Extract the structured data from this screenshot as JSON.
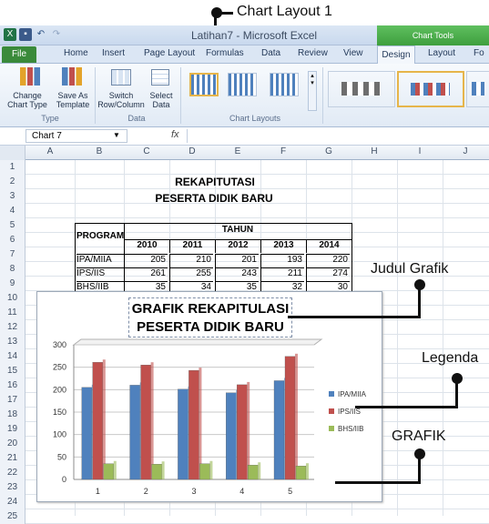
{
  "annotations": {
    "chart_layout": "Chart Layout 1",
    "judul": "Judul Grafik",
    "legenda": "Legenda",
    "grafik": "GRAFIK"
  },
  "window": {
    "title": "Latihan7 - Microsoft Excel",
    "context_tab": "Chart Tools"
  },
  "tabs": [
    "File",
    "Home",
    "Insert",
    "Page Layout",
    "Formulas",
    "Data",
    "Review",
    "View",
    "Design",
    "Layout",
    "Fo"
  ],
  "ribbon": {
    "change_chart_type": "Change\nChart Type",
    "save_as_template": "Save As\nTemplate",
    "group_type": "Type",
    "switch": "Switch\nRow/Column",
    "select_data": "Select\nData",
    "group_data": "Data",
    "group_chart_layouts": "Chart Layouts"
  },
  "formula": {
    "name_box": "Chart 7",
    "fx": "fx"
  },
  "columns": [
    "A",
    "B",
    "C",
    "D",
    "E",
    "F",
    "G",
    "H",
    "I",
    "J"
  ],
  "rows": [
    "1",
    "2",
    "3",
    "4",
    "5",
    "6",
    "7",
    "8",
    "9",
    "10",
    "11",
    "12",
    "13",
    "14",
    "15",
    "16",
    "17",
    "18",
    "19",
    "20",
    "21",
    "22",
    "23",
    "24",
    "25"
  ],
  "sheet": {
    "title1": "REKAPITUTASI",
    "title2": "PESERTA DIDIK BARU",
    "hdr_program": "PROGRAM",
    "hdr_tahun": "TAHUN",
    "years": [
      "2010",
      "2011",
      "2012",
      "2013",
      "2014"
    ],
    "rows": [
      {
        "program": "IPA/MIIA",
        "values": [
          "205",
          "210",
          "201",
          "193",
          "220"
        ]
      },
      {
        "program": "IPS/IIS",
        "values": [
          "261",
          "255",
          "243",
          "211",
          "274"
        ]
      },
      {
        "program": "BHS/IIB",
        "values": [
          "35",
          "34",
          "35",
          "32",
          "30"
        ]
      }
    ]
  },
  "chart_data": {
    "type": "bar",
    "title": "GRAFIK REKAPITULASI PESERTA DIDIK BARU",
    "title_line1": "GRAFIK REKAPITULASI",
    "title_line2": "PESERTA DIDIK BARU",
    "categories": [
      "1",
      "2",
      "3",
      "4",
      "5"
    ],
    "series": [
      {
        "name": "IPA/MIIA",
        "values": [
          205,
          210,
          201,
          193,
          220
        ],
        "color": "#4f81bd"
      },
      {
        "name": "IPS/IIS",
        "values": [
          261,
          255,
          243,
          211,
          274
        ],
        "color": "#c0504d"
      },
      {
        "name": "BHS/IIB",
        "values": [
          35,
          34,
          35,
          32,
          30
        ],
        "color": "#9bbb59"
      }
    ],
    "ylim": [
      0,
      300
    ],
    "yticks": [
      "0",
      "50",
      "100",
      "150",
      "200",
      "250",
      "300"
    ],
    "legend": "right",
    "grid": true
  }
}
